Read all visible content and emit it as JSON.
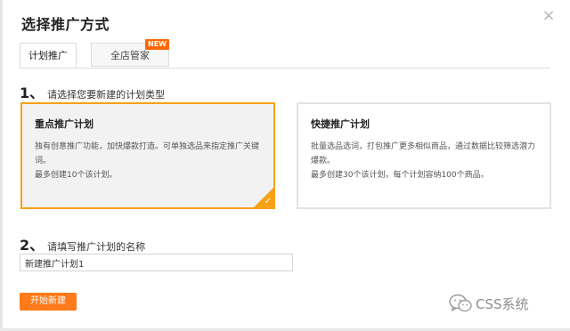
{
  "dialog": {
    "title": "选择推广方式",
    "close_label": "×"
  },
  "tabs": [
    {
      "label": "计划推广",
      "active": true
    },
    {
      "label": "全店管家",
      "active": false,
      "badge": "NEW"
    }
  ],
  "step1": {
    "number": "1、",
    "label": "请选择您要新建的计划类型"
  },
  "plans": [
    {
      "title": "重点推广计划",
      "desc1": "独有创意推广功能，加快爆款打造。可单独选品来指定推广关键词。",
      "desc2": "最多创建10个该计划。",
      "selected": true
    },
    {
      "title": "快捷推广计划",
      "desc1": "批量选品选词，打包推广更多相似商品，通过数据比较筛选潜力爆款。",
      "desc2": "最多创建30个该计划，每个计划容纳100个商品。",
      "selected": false
    }
  ],
  "step2": {
    "number": "2、",
    "label": "请填写推广计划的名称"
  },
  "name_input": {
    "value": "新建推广计划1"
  },
  "start_button": {
    "label": "开始新建"
  },
  "watermark": {
    "text": "CSS系统",
    "icon": "wechat-icon"
  },
  "colors": {
    "accent_orange": "#f6a015",
    "button_orange": "#ff7a1a",
    "badge_orange": "#ff6600"
  }
}
